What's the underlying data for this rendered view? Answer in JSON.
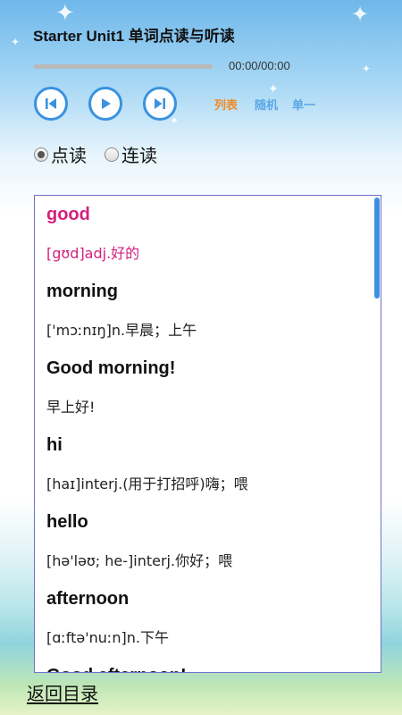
{
  "header": {
    "title": "Starter Unit1 单词点读与听读"
  },
  "player": {
    "time": "00:00/00:00",
    "progress": 0,
    "controls": [
      {
        "name": "previous-button",
        "icon": "skip-previous-icon"
      },
      {
        "name": "play-button",
        "icon": "play-icon"
      },
      {
        "name": "next-button",
        "icon": "skip-next-icon"
      }
    ],
    "modes": [
      {
        "label": "列表",
        "color": "#f08a24"
      },
      {
        "label": "随机",
        "color": "#5aa7e6"
      },
      {
        "label": "单一",
        "color": "#5aa7e6"
      }
    ]
  },
  "read_mode": {
    "options": [
      {
        "label": "点读",
        "selected": true
      },
      {
        "label": "连读",
        "selected": false
      }
    ]
  },
  "entries": [
    {
      "word": "good",
      "meaning": "[gʊd]adj.好的",
      "active": true
    },
    {
      "word": "morning",
      "meaning": "['mɔːnɪŋ]n.早晨；上午",
      "active": false
    },
    {
      "word": "Good morning!",
      "meaning": "早上好!",
      "active": false
    },
    {
      "word": "hi",
      "meaning": "[haɪ]interj.(用于打招呼)嗨；喂",
      "active": false
    },
    {
      "word": "hello",
      "meaning": "[hə'ləʊ; he-]interj.你好；喂",
      "active": false
    },
    {
      "word": "afternoon",
      "meaning": "[ɑːftə'nuːn]n.下午",
      "active": false
    },
    {
      "word": "Good afternoon!",
      "meaning": "",
      "active": false
    }
  ],
  "footer": {
    "back_label": "返回目录"
  },
  "colors": {
    "accent": "#3a92e0",
    "highlight": "#d4217f",
    "border": "#6f72c9"
  }
}
